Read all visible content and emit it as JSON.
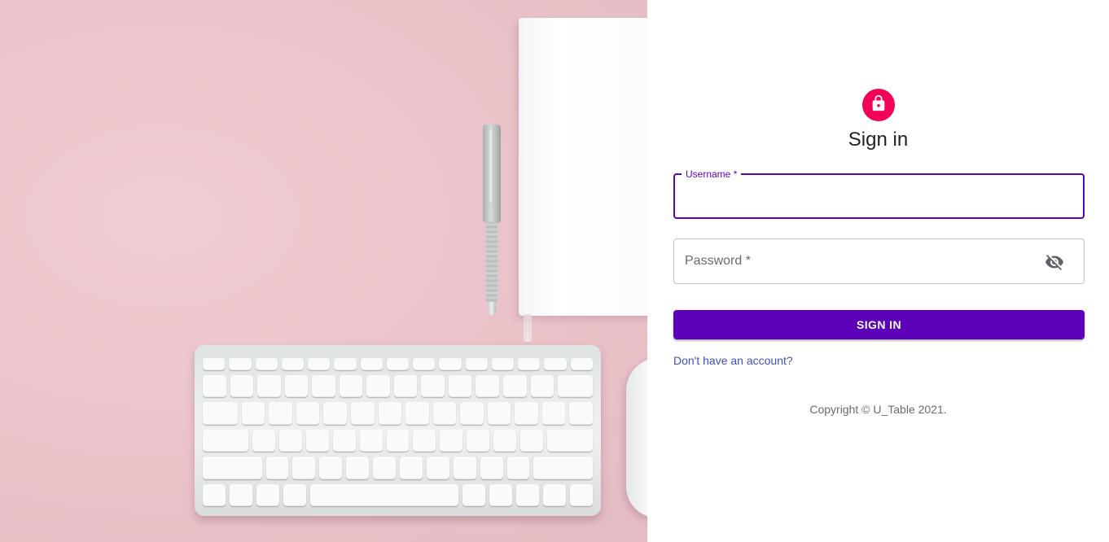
{
  "hero": {
    "description_icon": "keyboard-pen-notebook-photo"
  },
  "login": {
    "avatar_icon": "lock-icon",
    "title": "Sign in",
    "username": {
      "label": "Username *",
      "value": ""
    },
    "password": {
      "label": "Password *",
      "value": "",
      "toggle_icon": "visibility-off-icon"
    },
    "submit_label": "SIGN IN",
    "signup_link": "Don't have an account?",
    "copyright": "Copyright © U_Table 2021."
  },
  "colors": {
    "primary": "#5c02b8",
    "accent": "#f50057",
    "link": "#3f51b5",
    "hero_bg": "#ecc6cc"
  }
}
